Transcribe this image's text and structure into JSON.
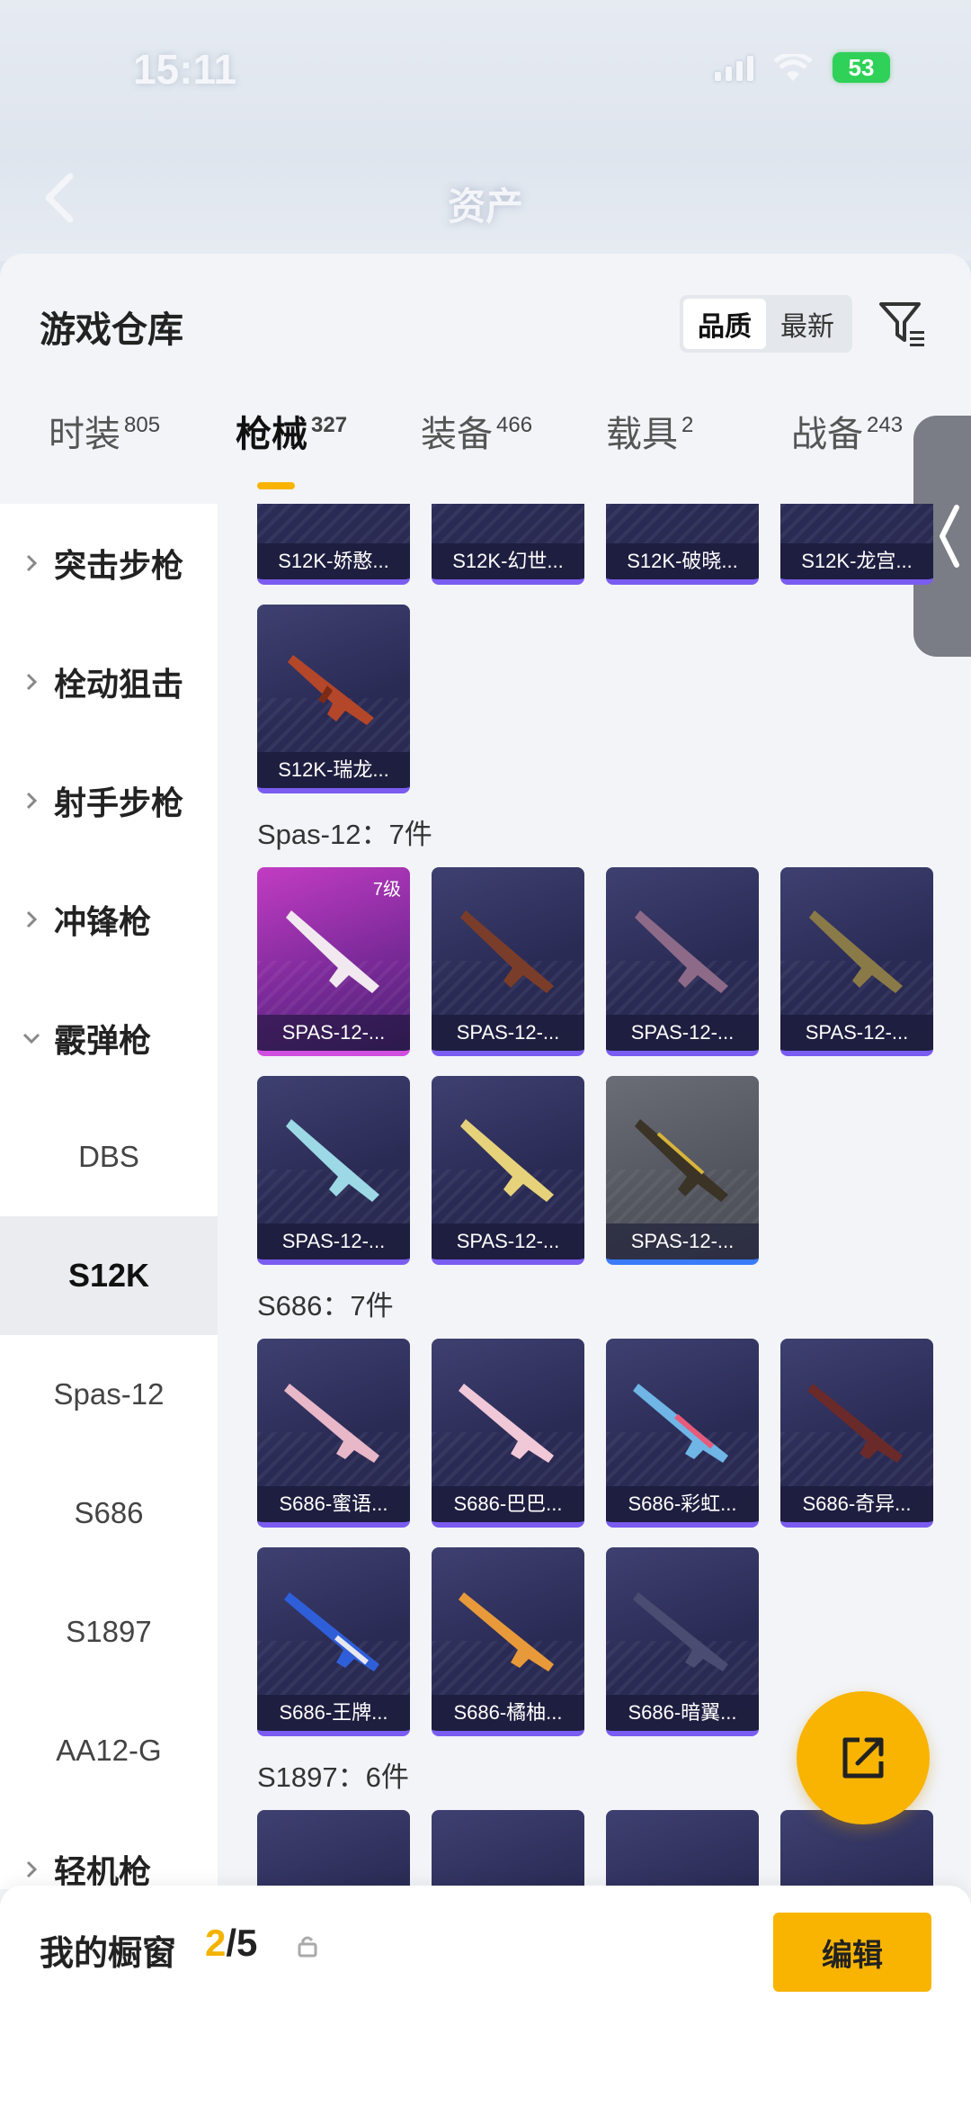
{
  "status": {
    "time": "15:11",
    "battery": "53"
  },
  "header": {
    "title": "资产"
  },
  "panel": {
    "title": "游戏仓库",
    "sort": {
      "quality": "品质",
      "latest": "最新"
    }
  },
  "tabs": [
    {
      "label": "时装",
      "count": "805"
    },
    {
      "label": "枪械",
      "count": "327"
    },
    {
      "label": "装备",
      "count": "466"
    },
    {
      "label": "载具",
      "count": "2"
    },
    {
      "label": "战备",
      "count": "243"
    }
  ],
  "sidebar": {
    "categories": [
      "突击步枪",
      "栓动狙击",
      "射手步枪",
      "冲锋枪",
      "霰弹枪"
    ],
    "subs": [
      "DBS",
      "S12K",
      "Spas-12",
      "S686",
      "S1897",
      "AA12-G"
    ],
    "more": "轻机枪"
  },
  "groups": {
    "s12k_row": [
      "S12K-娇憨...",
      "S12K-幻世...",
      "S12K-破晓...",
      "S12K-龙宫..."
    ],
    "s12k_extra": "S12K-瑞龙...",
    "spas_label": "Spas-12：7件",
    "spas_items": [
      "SPAS-12-...",
      "SPAS-12-...",
      "SPAS-12-...",
      "SPAS-12-...",
      "SPAS-12-...",
      "SPAS-12-...",
      "SPAS-12-..."
    ],
    "spas_level": "7级",
    "s686_label": "S686：7件",
    "s686_items": [
      "S686-蜜语...",
      "S686-巴巴...",
      "S686-彩虹...",
      "S686-奇异...",
      "S686-王牌...",
      "S686-橘柚...",
      "S686-暗翼..."
    ],
    "s1897_label": "S1897：6件"
  },
  "bottom": {
    "showcase_label": "我的橱窗",
    "showcase_current": "2",
    "showcase_total": "/5",
    "edit": "编辑"
  },
  "icons": [
    "back-icon",
    "filter-icon",
    "collapse-icon",
    "share-icon",
    "lock-icon",
    "chevron-right-icon",
    "chevron-down-icon"
  ],
  "colors": {
    "accent": "#f8b400",
    "card_purple": "#2a2b55",
    "card_pink": "#c23cc3",
    "card_grey": "#5c5f68"
  }
}
